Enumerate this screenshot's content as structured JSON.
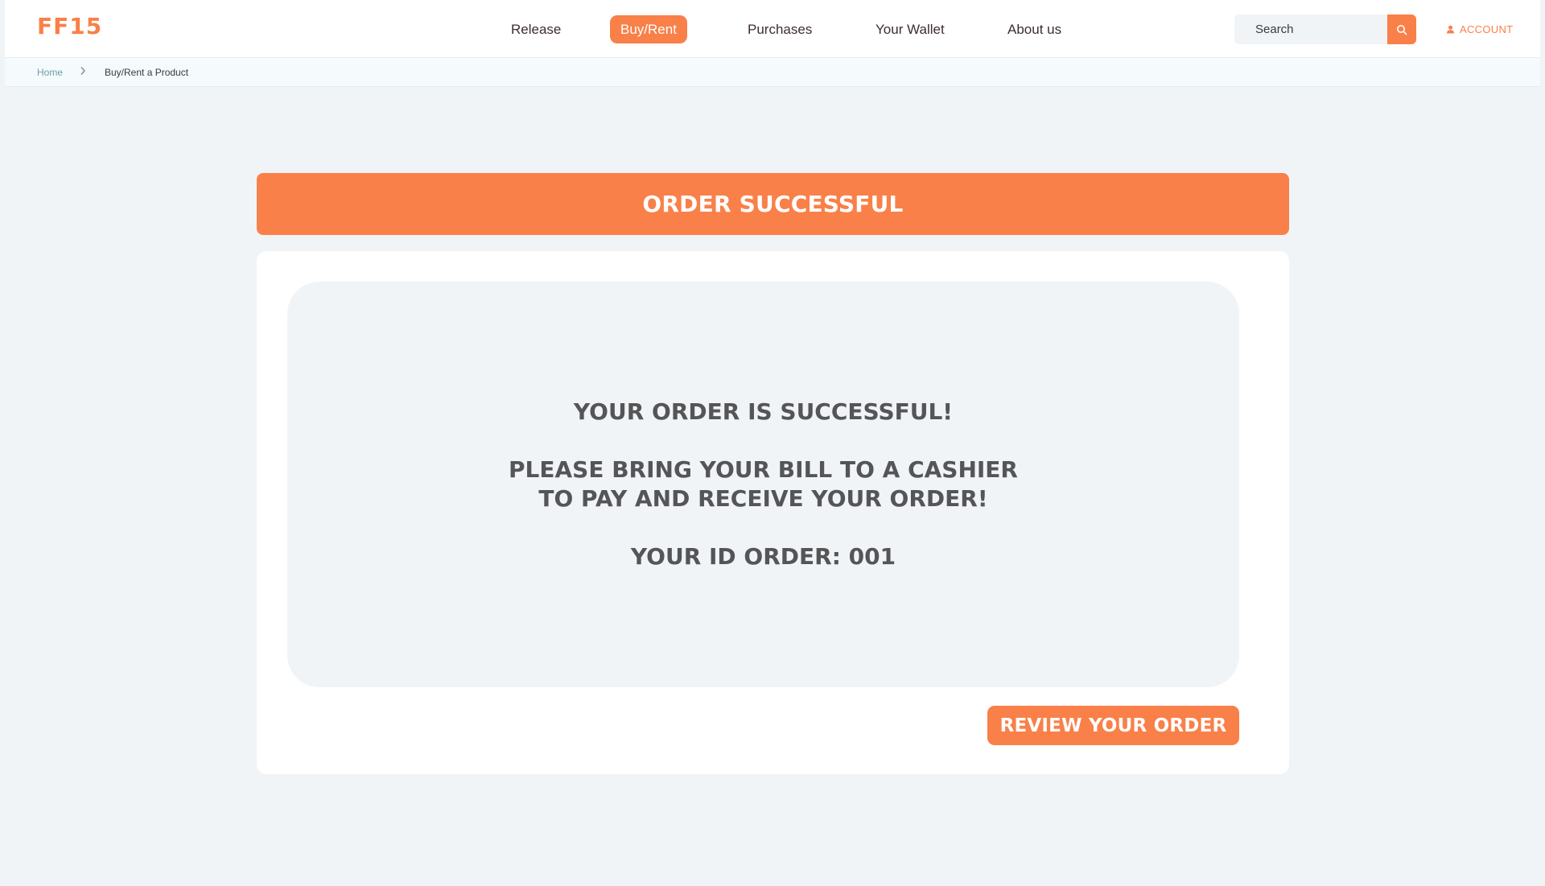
{
  "header": {
    "logo": "FF15",
    "nav": [
      {
        "label": "Release",
        "active": false
      },
      {
        "label": "Buy/Rent",
        "active": true
      },
      {
        "label": "Purchases",
        "active": false
      },
      {
        "label": "Your Wallet",
        "active": false
      },
      {
        "label": "About us",
        "active": false
      }
    ],
    "search": {
      "placeholder": "Search",
      "value": "",
      "icon": "search-icon"
    },
    "account": {
      "label": "ACCOUNT",
      "icon": "user-icon"
    }
  },
  "breadcrumb": {
    "home": "Home",
    "current": "Buy/Rent a Product",
    "separator_icon": "chevron-right-icon"
  },
  "main": {
    "banner_title": "ORDER SUCCESSFUL",
    "messages": {
      "line1": "YOUR ORDER IS SUCCESSFUL!",
      "line2": "PLEASE BRING YOUR BILL TO A CASHIER",
      "line3": "TO PAY AND RECEIVE YOUR ORDER!",
      "line4": "YOUR ID ORDER: 001"
    },
    "review_button": "REVIEW YOUR ORDER"
  },
  "colors": {
    "accent": "#f98049",
    "background": "#f0f4f7",
    "card": "#ffffff",
    "text": "#555557"
  }
}
